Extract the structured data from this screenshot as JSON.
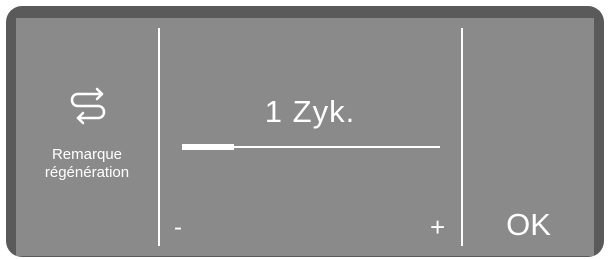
{
  "settings": {
    "icon": "regeneration-arrows-icon",
    "label_line1": "Remarque",
    "label_line2": "régénération"
  },
  "value": {
    "text": "1 Zyk.",
    "level": 0.2
  },
  "controls": {
    "minus_label": "-",
    "plus_label": "+",
    "ok_label": "OK"
  },
  "colors": {
    "frame": "#5a5a5a",
    "screen": "#8a8a8a",
    "foreground": "#ffffff"
  }
}
